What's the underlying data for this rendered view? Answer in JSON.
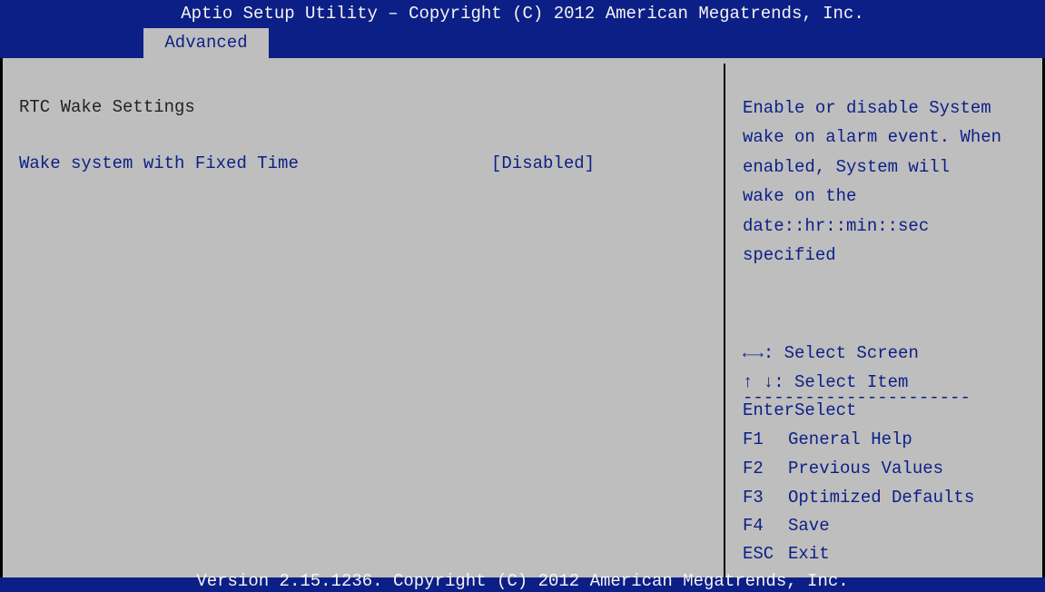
{
  "header": {
    "title": "Aptio Setup Utility – Copyright (C) 2012 American Megatrends, Inc."
  },
  "tabs": [
    {
      "label": "Advanced",
      "selected": true
    }
  ],
  "main": {
    "section_title": "RTC Wake Settings",
    "settings": [
      {
        "label": "Wake system with Fixed Time",
        "value": "[Disabled]"
      }
    ]
  },
  "help": {
    "text": "Enable or disable System\nwake on alarm event. When\nenabled, System will\nwake on the\ndate::hr::min::sec\nspecified",
    "separator": "----------------------",
    "keys": [
      {
        "key": "←→",
        "desc": ": Select Screen"
      },
      {
        "key": "↑ ↓",
        "desc": ": Select Item"
      },
      {
        "key": "Enter",
        "desc": "Select"
      },
      {
        "key": "F1",
        "desc": "General Help"
      },
      {
        "key": "F2",
        "desc": "Previous Values"
      },
      {
        "key": "F3",
        "desc": "Optimized Defaults"
      },
      {
        "key": "F4",
        "desc": "Save"
      },
      {
        "key": "ESC",
        "desc": "Exit"
      }
    ]
  },
  "footer": {
    "version": "Version 2.15.1236. Copyright (C) 2012 American Megatrends, Inc."
  },
  "colors": {
    "bar_blue": "#0c1f86",
    "panel_gray": "#bebebe",
    "bar_text": "#f4f4f4"
  }
}
